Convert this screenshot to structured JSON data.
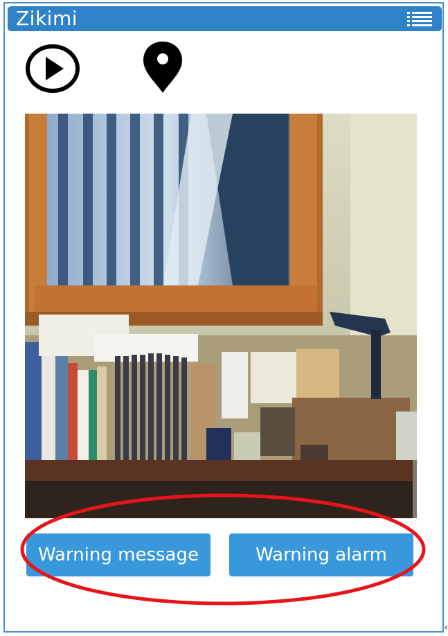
{
  "app": {
    "title": "Zikimi"
  },
  "toolbar": {
    "menu_icon": "list-menu-icon",
    "play_icon": "play-circle-icon",
    "location_icon": "map-pin-icon"
  },
  "camera": {
    "feed": "live-camera-view"
  },
  "actions": {
    "warning_message_label": "Warning message",
    "warning_alarm_label": "Warning alarm"
  },
  "colors": {
    "header_bg": "#2f82c8",
    "button_bg": "#3998dc",
    "annotation": "#e8141a"
  }
}
